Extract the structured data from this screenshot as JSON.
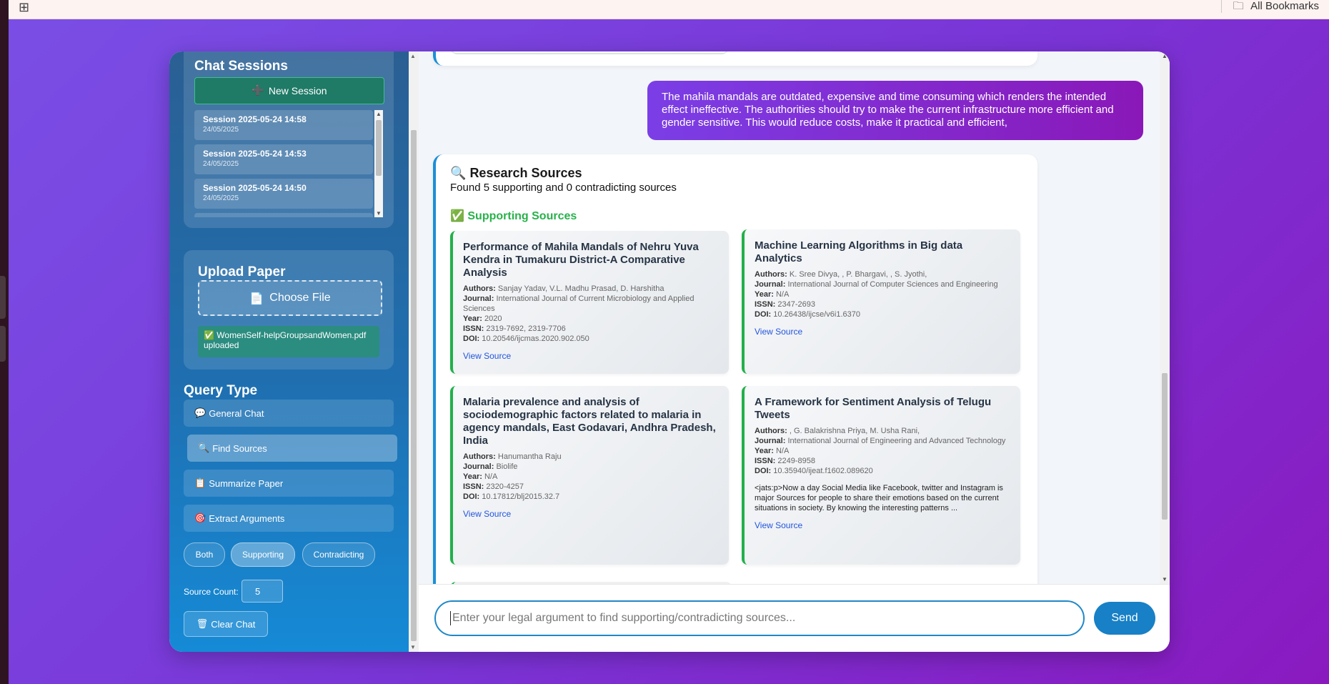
{
  "browser": {
    "bookmarks_label": "All Bookmarks"
  },
  "sidebar": {
    "sessions_title": "Chat Sessions",
    "new_session_label": "New Session",
    "sessions": [
      {
        "name": "Session 2025-05-24 14:58",
        "date": "24/05/2025"
      },
      {
        "name": "Session 2025-05-24 14:53",
        "date": "24/05/2025"
      },
      {
        "name": "Session 2025-05-24 14:50",
        "date": "24/05/2025"
      }
    ],
    "upload_title": "Upload Paper",
    "choose_file_label": "Choose File",
    "upload_status": "WomenSelf-helpGroupsandWomen.pdf uploaded",
    "query_title": "Query Type",
    "query_types": [
      {
        "label": "General Chat",
        "icon": "speech-bubble-icon"
      },
      {
        "label": "Find Sources",
        "icon": "magnifier-icon",
        "active": true
      },
      {
        "label": "Summarize Paper",
        "icon": "clipboard-icon"
      },
      {
        "label": "Extract Arguments",
        "icon": "target-icon"
      }
    ],
    "filters": [
      "Both",
      "Supporting",
      "Contradicting"
    ],
    "active_filter": "Supporting",
    "source_count_label": "Source Count:",
    "source_count_value": "5",
    "clear_chat_label": "Clear Chat"
  },
  "chat": {
    "user_message": "The mahila mandals are outdated, expensive and time consuming which renders the intended effect ineffective. The authorities should try to make the current infrastructure more efficient and gender sensitive. This would reduce costs, make it practical and efficient,",
    "research": {
      "title": "Research Sources",
      "summary": "Found 5 supporting and 0 contradicting sources",
      "supporting_heading": "Supporting Sources",
      "labels": {
        "authors": "Authors:",
        "journal": "Journal:",
        "year": "Year:",
        "issn": "ISSN:",
        "doi": "DOI:",
        "view": "View Source"
      },
      "sources": [
        {
          "title": "Performance of Mahila Mandals of Nehru Yuva Kendra in Tumakuru District-A Comparative Analysis",
          "authors": "Sanjay Yadav, V.L. Madhu Prasad, D. Harshitha",
          "journal": "International Journal of Current Microbiology and Applied Sciences",
          "year": "2020",
          "issn": "2319-7692, 2319-7706",
          "doi": "10.20546/ijcmas.2020.902.050",
          "abstract": ""
        },
        {
          "title": "Machine Learning Algorithms in Big data Analytics",
          "authors": "K. Sree Divya, , P. Bhargavi, , S. Jyothi,",
          "journal": "International Journal of Computer Sciences and Engineering",
          "year": "N/A",
          "issn": "2347-2693",
          "doi": "10.26438/ijcse/v6i1.6370",
          "abstract": ""
        },
        {
          "title": "Malaria prevalence and analysis of sociodemographic factors related to malaria in agency mandals, East Godavari, Andhra Pradesh, India",
          "authors": "Hanumantha Raju",
          "journal": "Biolife",
          "year": "N/A",
          "issn": "2320-4257",
          "doi": "10.17812/blj2015.32.7",
          "abstract": ""
        },
        {
          "title": "A Framework for Sentiment Analysis of Telugu Tweets",
          "authors": ", G. Balakrishna Priya, M. Usha Rani,",
          "journal": "International Journal of Engineering and Advanced Technology",
          "year": "N/A",
          "issn": "2249-8958",
          "doi": "10.35940/ijeat.f1602.089620",
          "abstract": "<jats:p>Now a day Social Media like Facebook, twitter and Instagram is major Sources for people to share their emotions based on the current situations in society. By knowing the interesting patterns ..."
        }
      ]
    },
    "input_placeholder": "Enter your legal argument to find supporting/contradicting sources...",
    "send_label": "Send"
  },
  "colors": {
    "background_start": "#7a4fe6",
    "background_end": "#8a1ac0",
    "sidebar_top": "#2a5f93",
    "sidebar_bottom": "#158ad6",
    "supporting_green": "#27b24a",
    "accent_blue": "#1780c6"
  }
}
